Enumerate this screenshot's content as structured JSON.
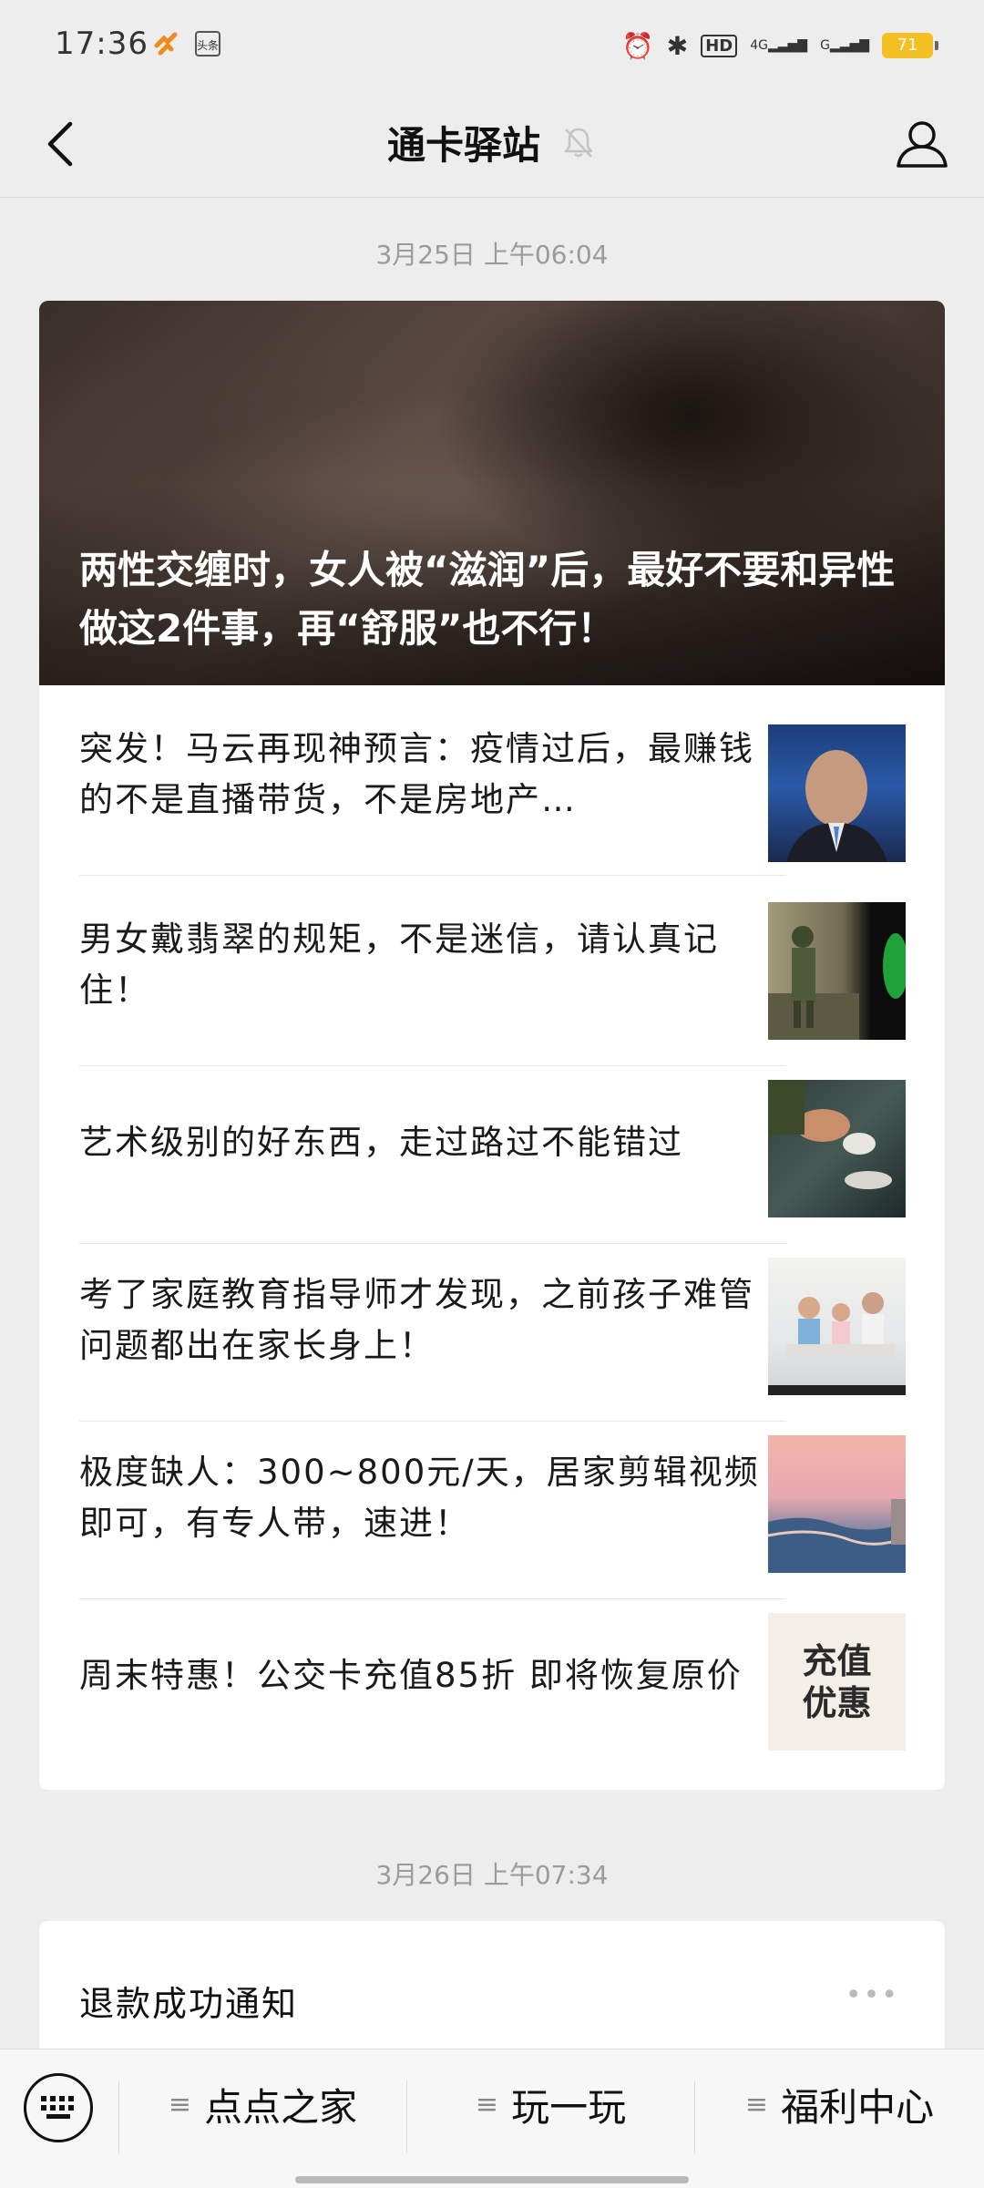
{
  "status_bar": {
    "time": "17:36",
    "app2_label": "头条",
    "hd": "HD",
    "net1": "4G",
    "net2": "G",
    "battery": "71"
  },
  "header": {
    "title": "通卡驿站"
  },
  "messages": [
    {
      "timestamp": "3月25日 上午06:04",
      "hero_title": "两性交缠时，女人被“滋润”后，最好不要和异性做这2件事，再“舒服”也不行！",
      "items": [
        {
          "title": "突发！马云再现神预言：疫情过后，最赚钱的不是直播带货，不是房地产…"
        },
        {
          "title": "男女戴翡翠的规矩，不是迷信，请认真记住！"
        },
        {
          "title": "艺术级别的好东西，走过路过不能错过"
        },
        {
          "title": "考了家庭教育指导师才发现，之前孩子难管问题都出在家长身上！"
        },
        {
          "title": "极度缺人：300~800元/天，居家剪辑视频即可，有专人带，速进！"
        },
        {
          "title": "周末特惠！公交卡充值85折 即将恢复原价",
          "thumb_text_1": "充值",
          "thumb_text_2": "优惠"
        }
      ]
    },
    {
      "timestamp": "3月26日 上午07:34",
      "notice_title": "退款成功通知",
      "more": "•••"
    }
  ],
  "bottom_menu": {
    "items": [
      {
        "label": "点点之家"
      },
      {
        "label": "玩一玩"
      },
      {
        "label": "福利中心"
      }
    ]
  }
}
